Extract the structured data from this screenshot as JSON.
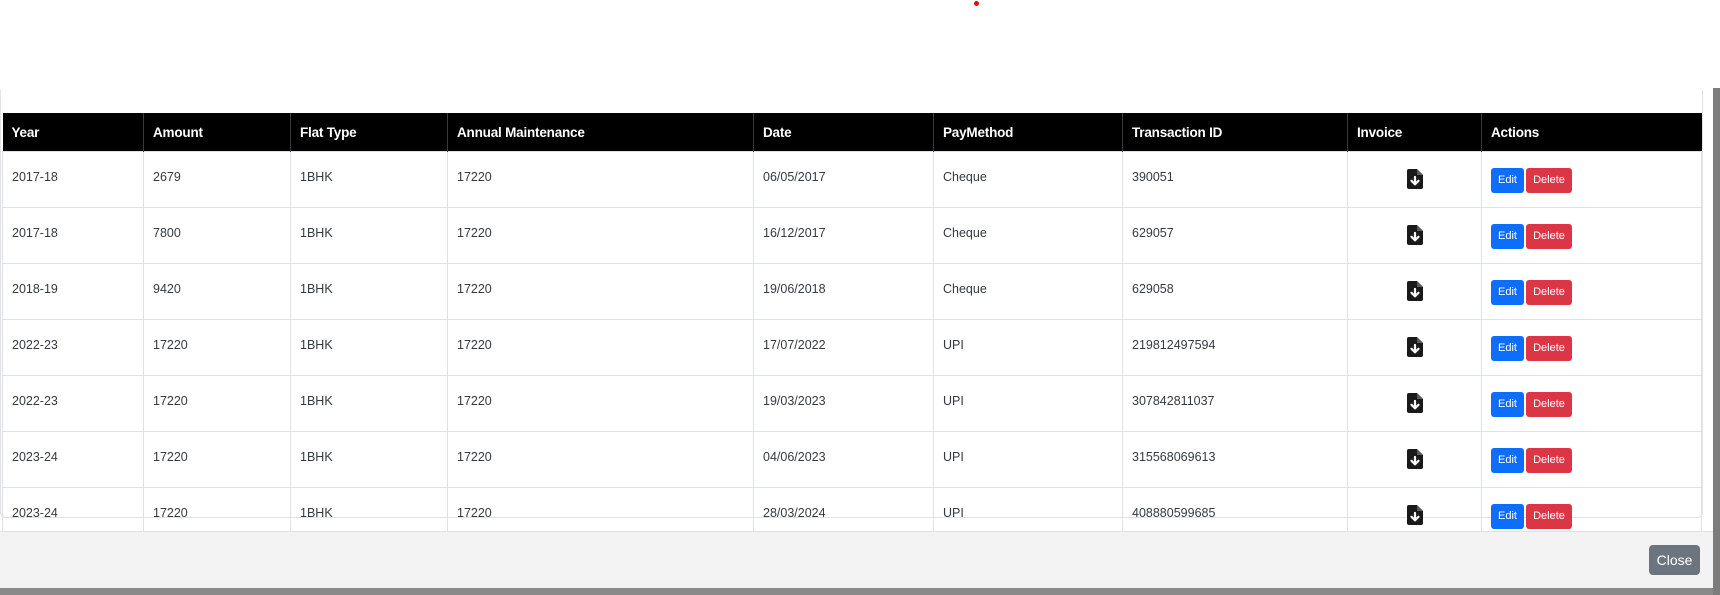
{
  "table": {
    "headers": [
      "Year",
      "Amount",
      "Flat Type",
      "Annual Maintenance",
      "Date",
      "PayMethod",
      "Transaction ID",
      "Invoice",
      "Actions"
    ],
    "rows": [
      {
        "year": "2017-18",
        "amount": "2679",
        "flat_type": "1BHK",
        "annual_maintenance": "17220",
        "date": "06/05/2017",
        "pay_method": "Cheque",
        "transaction_id": "390051"
      },
      {
        "year": "2017-18",
        "amount": "7800",
        "flat_type": "1BHK",
        "annual_maintenance": "17220",
        "date": "16/12/2017",
        "pay_method": "Cheque",
        "transaction_id": "629057"
      },
      {
        "year": "2018-19",
        "amount": "9420",
        "flat_type": "1BHK",
        "annual_maintenance": "17220",
        "date": "19/06/2018",
        "pay_method": "Cheque",
        "transaction_id": "629058"
      },
      {
        "year": "2022-23",
        "amount": "17220",
        "flat_type": "1BHK",
        "annual_maintenance": "17220",
        "date": "17/07/2022",
        "pay_method": "UPI",
        "transaction_id": "219812497594"
      },
      {
        "year": "2022-23",
        "amount": "17220",
        "flat_type": "1BHK",
        "annual_maintenance": "17220",
        "date": "19/03/2023",
        "pay_method": "UPI",
        "transaction_id": "307842811037"
      },
      {
        "year": "2023-24",
        "amount": "17220",
        "flat_type": "1BHK",
        "annual_maintenance": "17220",
        "date": "04/06/2023",
        "pay_method": "UPI",
        "transaction_id": "315568069613"
      },
      {
        "year": "2023-24",
        "amount": "17220",
        "flat_type": "1BHK",
        "annual_maintenance": "17220",
        "date": "28/03/2024",
        "pay_method": "UPI",
        "transaction_id": "408880599685"
      }
    ],
    "invoice_icon": "file-download-icon",
    "edit_label": "Edit",
    "delete_label": "Delete"
  },
  "footer": {
    "close_label": "Close"
  },
  "colors": {
    "header_bg": "#000000",
    "edit_button": "#0d6efd",
    "delete_button": "#dc3545",
    "close_button": "#6c757d"
  }
}
